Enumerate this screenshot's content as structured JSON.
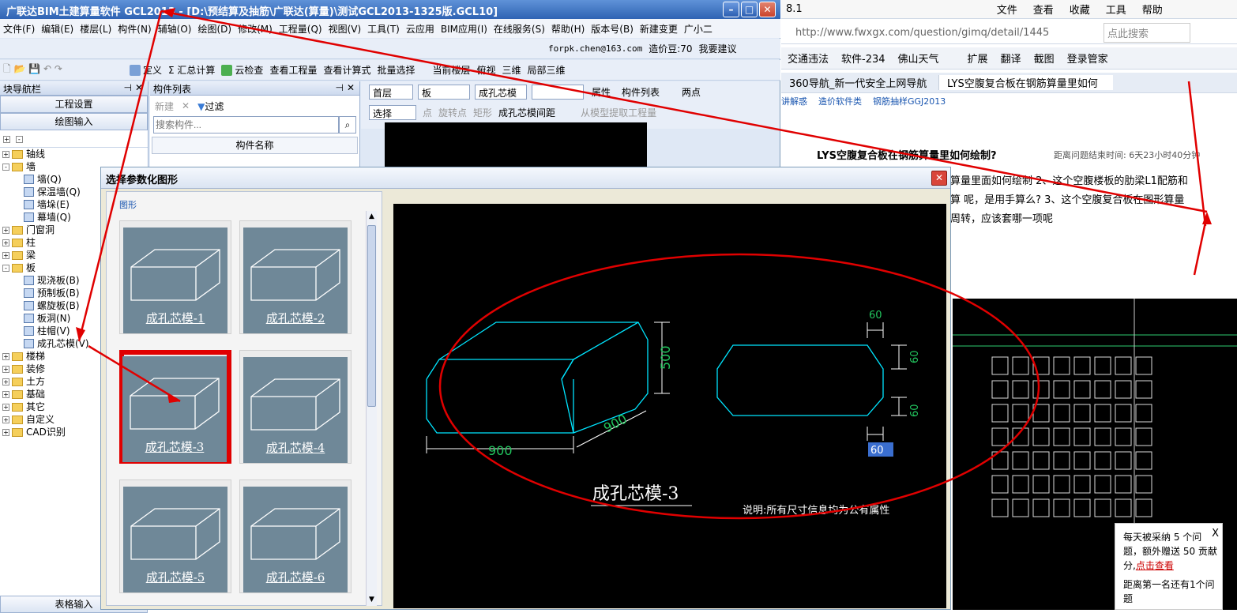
{
  "app": {
    "title": "广联达BIM土建算量软件 GCL2013 - [D:\\预结算及抽筋\\广联达(算量)\\测试GCL2013-1325版.GCL10]",
    "menu": [
      "文件(F)",
      "编辑(E)",
      "楼层(L)",
      "构件(N)",
      "辅轴(O)",
      "绘图(D)",
      "修改(M)",
      "工程量(Q)",
      "视图(V)",
      "工具(T)",
      "云应用",
      "BIM应用(I)",
      "在线服务(S)",
      "帮助(H)",
      "版本号(B)",
      "新建变更",
      "广小二"
    ],
    "toolbar1": {
      "define": "定义",
      "sum": "Σ 汇总计算",
      "cloud_check": "云检查",
      "view_qty": "查看工程量",
      "view_formula": "查看计算式",
      "batch_select": "批量选择",
      "current_floor": "当前楼层",
      "top_view": "俯视",
      "three_d": "三维",
      "partial_3d": "局部三维"
    },
    "account": {
      "email": "forpk.chen@163.com",
      "price_bean": "造价豆:70",
      "suggest": "我要建议"
    },
    "nav": {
      "title": "块导航栏",
      "project_settings": "工程设置",
      "drawing_input": "绘图输入",
      "tree": [
        {
          "label": "轴线",
          "level": 0,
          "exp": "+"
        },
        {
          "label": "墙",
          "level": 0,
          "exp": "-"
        },
        {
          "label": "墙(Q)",
          "level": 1
        },
        {
          "label": "保温墙(Q)",
          "level": 1
        },
        {
          "label": "墙垛(E)",
          "level": 1
        },
        {
          "label": "幕墙(Q)",
          "level": 1
        },
        {
          "label": "门窗洞",
          "level": 0,
          "exp": "+"
        },
        {
          "label": "柱",
          "level": 0,
          "exp": "+"
        },
        {
          "label": "梁",
          "level": 0,
          "exp": "+"
        },
        {
          "label": "板",
          "level": 0,
          "exp": "-"
        },
        {
          "label": "现浇板(B)",
          "level": 1
        },
        {
          "label": "预制板(B)",
          "level": 1
        },
        {
          "label": "螺旋板(B)",
          "level": 1
        },
        {
          "label": "板洞(N)",
          "level": 1
        },
        {
          "label": "柱帽(V)",
          "level": 1
        },
        {
          "label": "成孔芯模(V)",
          "level": 1
        },
        {
          "label": "楼梯",
          "level": 0,
          "exp": "+"
        },
        {
          "label": "装修",
          "level": 0,
          "exp": "+"
        },
        {
          "label": "土方",
          "level": 0,
          "exp": "+"
        },
        {
          "label": "基础",
          "level": 0,
          "exp": "+"
        },
        {
          "label": "其它",
          "level": 0,
          "exp": "+"
        },
        {
          "label": "自定义",
          "level": 0,
          "exp": "+"
        },
        {
          "label": "CAD识别",
          "level": 0,
          "exp": "+"
        }
      ],
      "bottom": "表格输入"
    },
    "complist": {
      "title": "构件列表",
      "new": "新建",
      "filter": "过滤",
      "search_placeholder": "搜索构件...",
      "col_name": "构件名称"
    },
    "floor_bar": {
      "floor": "首层",
      "type": "板",
      "comp": "成孔芯模",
      "props": "属性",
      "list": "构件列表",
      "two_points": "两点"
    },
    "draw_bar": {
      "select": "选择",
      "point": "点",
      "rotate_point": "旋转点",
      "rect": "矩形",
      "spacing": "成孔芯模间距",
      "extract": "从模型提取工程量"
    }
  },
  "dialog": {
    "title": "选择参数化图形",
    "group_label": "图形",
    "shapes": [
      "成孔芯模-1",
      "成孔芯模-2",
      "成孔芯模-3",
      "成孔芯模-4",
      "成孔芯模-5",
      "成孔芯模-6"
    ],
    "selected": "成孔芯模-3",
    "preview": {
      "name": "成孔芯模-3",
      "dim_width": "900",
      "dim_depth": "900",
      "dim_height": "500",
      "chamfer_top": "60",
      "chamfer_right1": "60",
      "chamfer_right2": "60",
      "chamfer_edit": "60",
      "note": "说明:所有尺寸信息均为公有属性"
    }
  },
  "browser": {
    "version": "8.1",
    "menu": [
      "文件",
      "查看",
      "收藏",
      "工具",
      "帮助"
    ],
    "url": "http://www.fwxgx.com/question/gimq/detail/1445",
    "search_placeholder": "点此搜索",
    "favbar": [
      "交通违法",
      "软件-234",
      "佛山天气",
      "扩展",
      "翻译",
      "截图",
      "登录管家"
    ],
    "tabs": [
      "360导航_新一代安全上网导航",
      "LYS空腹复合板在钢筋算量里如何"
    ],
    "breadcrumb": [
      "讲解惑",
      "造价软件类",
      "钢筋抽样GGJ2013"
    ],
    "question_title": "LYS空腹复合板在钢筋算量里如何绘制?",
    "time_left": "距离问题结束时间: 6天23小时40分钟",
    "question_body": [
      "算量里面如何绘制 2、这个空腹楼板的肋梁L1配筋和",
      "算 呢，是用手算么? 3、这个空腹复合板在图形算量",
      "周转，应该套哪一项呢"
    ],
    "popup": {
      "line1": "每天被采纳 5 个问题，额外赠送 50 贡献分,",
      "link": "点击查看",
      "line2": "距离第一名还有1个问题"
    }
  },
  "colors": {
    "annotation": "#e00000",
    "cad_lines": "#00e5ff",
    "cad_dims": "#22c55e"
  }
}
